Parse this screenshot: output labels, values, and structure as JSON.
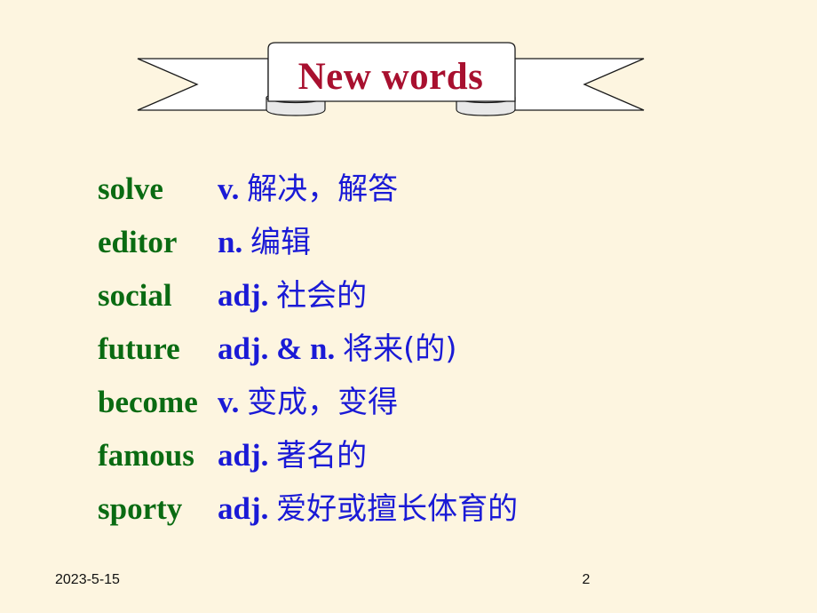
{
  "slide": {
    "background_color": "#fdf5e0",
    "title": "New words",
    "title_color": "#a8102f",
    "term_color": "#0a6b12",
    "definition_color": "#1a1ad6"
  },
  "banner": {
    "shape_name": "ribbon-banner",
    "fill": "#ffffff",
    "stroke": "#1a1a1a"
  },
  "words": [
    {
      "term": "solve",
      "pos": "v. ",
      "meaning": "解决，解答"
    },
    {
      "term": "editor",
      "pos": "n. ",
      "meaning": "编辑"
    },
    {
      "term": "social",
      "pos": "adj. ",
      "meaning": "社会的"
    },
    {
      "term": "future",
      "pos": "adj. & n. ",
      "meaning": "将来(的)"
    },
    {
      "term": "become",
      "pos": "v. ",
      "meaning": "变成，变得"
    },
    {
      "term": "famous",
      "pos": "adj. ",
      "meaning": "著名的"
    },
    {
      "term": "sporty",
      "pos": "adj. ",
      "meaning": "爱好或擅长体育的"
    }
  ],
  "footer": {
    "date": "2023-5-15",
    "page_number": "2"
  }
}
